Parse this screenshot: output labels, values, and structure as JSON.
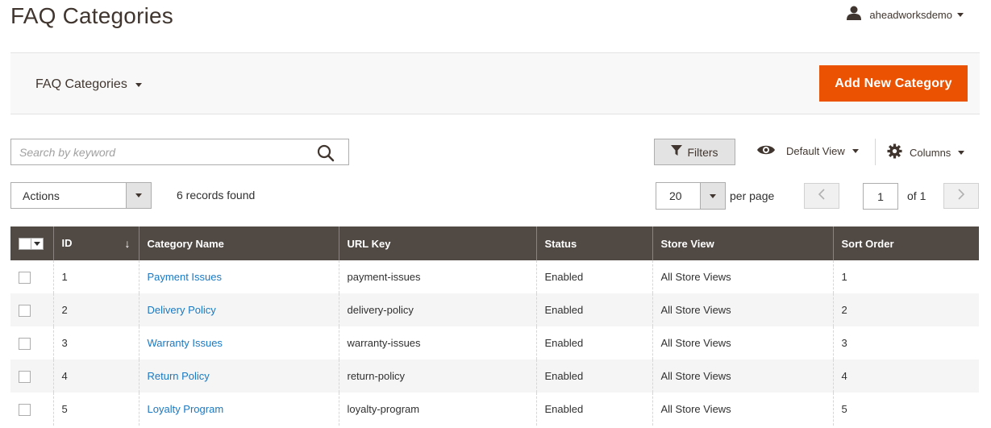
{
  "page": {
    "title": "FAQ Categories"
  },
  "user": {
    "name": "aheadworksdemo"
  },
  "actions_bar": {
    "switcher_label": "FAQ Categories",
    "add_button_label": "Add New Category"
  },
  "toolbar": {
    "search_placeholder": "Search by keyword",
    "filters_label": "Filters",
    "view_label": "Default View",
    "columns_label": "Columns",
    "actions_label": "Actions",
    "records_found": "6 records found",
    "per_page_value": "20",
    "per_page_label": "per page",
    "current_page": "1",
    "page_of": "of 1"
  },
  "grid": {
    "columns": [
      "ID",
      "Category Name",
      "URL Key",
      "Status",
      "Store View",
      "Sort Order"
    ],
    "sort_indicator": "↓",
    "rows": [
      {
        "id": "1",
        "name": "Payment Issues",
        "url_key": "payment-issues",
        "status": "Enabled",
        "store_view": "All Store Views",
        "sort_order": "1"
      },
      {
        "id": "2",
        "name": "Delivery Policy",
        "url_key": "delivery-policy",
        "status": "Enabled",
        "store_view": "All Store Views",
        "sort_order": "2"
      },
      {
        "id": "3",
        "name": "Warranty Issues",
        "url_key": "warranty-issues",
        "status": "Enabled",
        "store_view": "All Store Views",
        "sort_order": "3"
      },
      {
        "id": "4",
        "name": "Return Policy",
        "url_key": "return-policy",
        "status": "Enabled",
        "store_view": "All Store Views",
        "sort_order": "4"
      },
      {
        "id": "5",
        "name": "Loyalty Program",
        "url_key": "loyalty-program",
        "status": "Enabled",
        "store_view": "All Store Views",
        "sort_order": "5"
      }
    ]
  },
  "colors": {
    "accent": "#eb5202",
    "header_bg": "#514943",
    "link": "#1979c3"
  },
  "icons": {
    "user": "user-icon",
    "search": "search-icon",
    "filter": "filter-icon",
    "view": "eye-icon",
    "columns": "gear-icon"
  }
}
